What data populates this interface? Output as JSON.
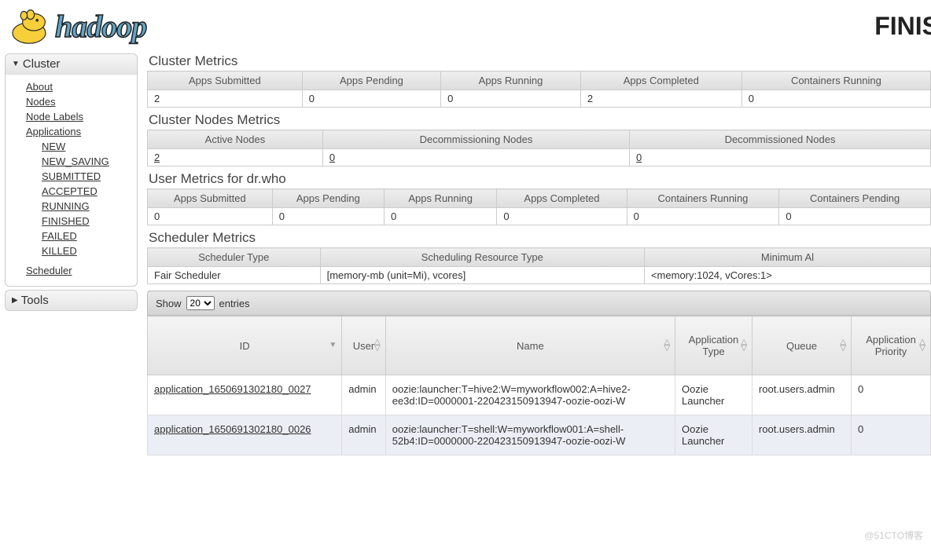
{
  "header": {
    "page_title": "FINIS",
    "logo_text": "hadoop"
  },
  "sidebar": {
    "cluster_label": "Cluster",
    "tools_label": "Tools",
    "items": {
      "about": "About",
      "nodes": "Nodes",
      "nodelabels": "Node Labels",
      "applications": "Applications",
      "new": "NEW",
      "new_saving": "NEW_SAVING",
      "submitted": "SUBMITTED",
      "accepted": "ACCEPTED",
      "running": "RUNNING",
      "finished": "FINISHED",
      "failed": "FAILED",
      "killed": "KILLED",
      "scheduler": "Scheduler"
    }
  },
  "cluster_metrics": {
    "title": "Cluster Metrics",
    "headers": [
      "Apps Submitted",
      "Apps Pending",
      "Apps Running",
      "Apps Completed",
      "Containers Running"
    ],
    "values": [
      "2",
      "0",
      "0",
      "2",
      "0"
    ]
  },
  "nodes_metrics": {
    "title": "Cluster Nodes Metrics",
    "headers": [
      "Active Nodes",
      "Decommissioning Nodes",
      "Decommissioned Nodes"
    ],
    "values": [
      "2",
      "0",
      "0"
    ]
  },
  "user_metrics": {
    "title": "User Metrics for dr.who",
    "headers": [
      "Apps Submitted",
      "Apps Pending",
      "Apps Running",
      "Apps Completed",
      "Containers Running",
      "Containers Pending"
    ],
    "values": [
      "0",
      "0",
      "0",
      "0",
      "0",
      "0"
    ]
  },
  "scheduler_metrics": {
    "title": "Scheduler Metrics",
    "headers": [
      "Scheduler Type",
      "Scheduling Resource Type",
      "Minimum Al"
    ],
    "values": [
      "Fair Scheduler",
      "[memory-mb (unit=Mi), vcores]",
      "<memory:1024, vCores:1>"
    ]
  },
  "apps": {
    "show_label_pre": "Show",
    "show_label_post": "entries",
    "show_value": "20",
    "columns": [
      "ID",
      "User",
      "Name",
      "Application Type",
      "Queue",
      "Application Priority"
    ],
    "rows": [
      {
        "id": "application_1650691302180_0027",
        "user": "admin",
        "name": "oozie:launcher:T=hive2:W=myworkflow002:A=hive2-ee3d:ID=0000001-220423150913947-oozie-oozi-W",
        "type": "Oozie Launcher",
        "queue": "root.users.admin",
        "priority": "0"
      },
      {
        "id": "application_1650691302180_0026",
        "user": "admin",
        "name": "oozie:launcher:T=shell:W=myworkflow001:A=shell-52b4:ID=0000000-220423150913947-oozie-oozi-W",
        "type": "Oozie Launcher",
        "queue": "root.users.admin",
        "priority": "0"
      }
    ]
  },
  "watermark": "@51CTO博客"
}
